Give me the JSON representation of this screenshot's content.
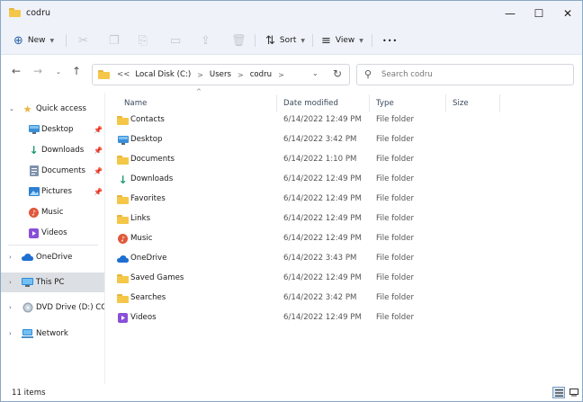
{
  "window": {
    "title": "codru",
    "controls": {
      "minimize": "—",
      "maximize": "☐",
      "close": "✕"
    }
  },
  "toolbar": {
    "new_label": "New",
    "sort_label": "Sort",
    "view_label": "View",
    "more_label": "•••"
  },
  "address": {
    "overflow": "<<",
    "crumbs": [
      "Local Disk (C:)",
      "Users",
      "codru"
    ]
  },
  "search": {
    "placeholder": "Search codru"
  },
  "nav": {
    "quick_access": "Quick access",
    "quick_items": [
      {
        "label": "Desktop",
        "icon": "desktop-icon"
      },
      {
        "label": "Downloads",
        "icon": "downloads-icon"
      },
      {
        "label": "Documents",
        "icon": "documents-icon"
      },
      {
        "label": "Pictures",
        "icon": "pictures-icon"
      },
      {
        "label": "Music",
        "icon": "music-icon"
      },
      {
        "label": "Videos",
        "icon": "videos-icon"
      }
    ],
    "onedrive": "OneDrive",
    "this_pc": "This PC",
    "dvd": "DVD Drive (D:) CCCOMA",
    "network": "Network"
  },
  "columns": {
    "name": "Name",
    "date": "Date modified",
    "type": "Type",
    "size": "Size"
  },
  "files": [
    {
      "name": "Contacts",
      "date": "6/14/2022 12:49 PM",
      "type": "File folder",
      "icon": "contacts-folder-icon"
    },
    {
      "name": "Desktop",
      "date": "6/14/2022 3:42 PM",
      "type": "File folder",
      "icon": "desktop-icon"
    },
    {
      "name": "Documents",
      "date": "6/14/2022 1:10 PM",
      "type": "File folder",
      "icon": "documents-icon"
    },
    {
      "name": "Downloads",
      "date": "6/14/2022 12:49 PM",
      "type": "File folder",
      "icon": "downloads-icon"
    },
    {
      "name": "Favorites",
      "date": "6/14/2022 12:49 PM",
      "type": "File folder",
      "icon": "favorites-folder-icon"
    },
    {
      "name": "Links",
      "date": "6/14/2022 12:49 PM",
      "type": "File folder",
      "icon": "links-folder-icon"
    },
    {
      "name": "Music",
      "date": "6/14/2022 12:49 PM",
      "type": "File folder",
      "icon": "music-icon"
    },
    {
      "name": "OneDrive",
      "date": "6/14/2022 3:43 PM",
      "type": "File folder",
      "icon": "onedrive-icon"
    },
    {
      "name": "Saved Games",
      "date": "6/14/2022 12:49 PM",
      "type": "File folder",
      "icon": "saved-games-folder-icon"
    },
    {
      "name": "Searches",
      "date": "6/14/2022 3:42 PM",
      "type": "File folder",
      "icon": "searches-folder-icon"
    },
    {
      "name": "Videos",
      "date": "6/14/2022 12:49 PM",
      "type": "File folder",
      "icon": "videos-icon"
    }
  ],
  "status": {
    "count": "11 items"
  },
  "colors": {
    "accent": "#2a5fa8",
    "folder": "#f4c748",
    "selected_nav": "#dcdfe3"
  }
}
